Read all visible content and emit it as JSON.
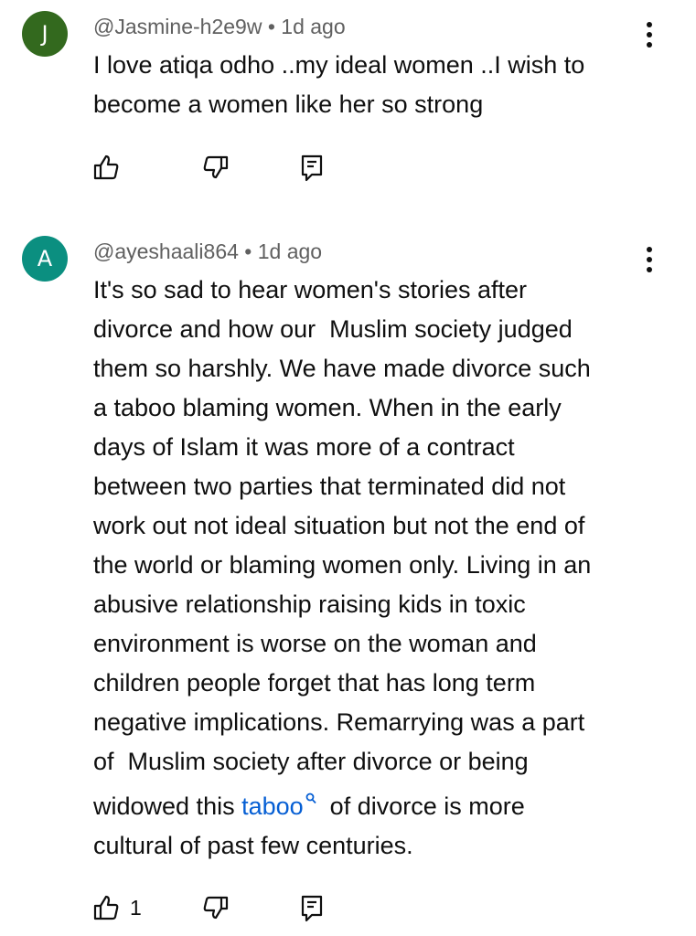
{
  "comments": [
    {
      "avatar_letter": "J",
      "avatar_color": "#33691e",
      "username": "@Jasmine-h2e9w",
      "separator": "•",
      "timestamp": "1d ago",
      "text_lines": [
        "I love atiqa odho ..my ideal women ..I wish to",
        "become a women like her so strong"
      ],
      "like_count": ""
    },
    {
      "avatar_letter": "A",
      "avatar_color": "#0b8f80",
      "username": "@ayeshaali864",
      "separator": "•",
      "timestamp": "1d ago",
      "text_lines": [
        "It's so sad to hear women's stories after",
        "divorce and how our  Muslim society judged",
        "them so harshly. We have made divorce such",
        "a taboo blaming women. When in the early",
        "days of Islam it was more of a contract",
        "between two parties that terminated did not",
        "work out not ideal situation but not the end of",
        "the world or blaming women only. Living in an",
        "abusive relationship raising kids in toxic",
        "environment is worse on the woman and",
        "children people forget that has long term",
        "negative implications. Remarrying was a part",
        "of  Muslim society after divorce or being"
      ],
      "link_line": {
        "before": "widowed this ",
        "link": "taboo",
        "after": "  of divorce is more"
      },
      "last_line": "cultural of past few centuries.",
      "like_count": "1"
    }
  ],
  "icons": {
    "menu": "more-vert-icon",
    "like": "thumb-up-icon",
    "dislike": "thumb-down-icon",
    "reply": "reply-comment-icon",
    "link_search": "search-icon"
  },
  "colors": {
    "link": "#065fd4",
    "meta": "#606060",
    "text": "#0f0f0f"
  }
}
